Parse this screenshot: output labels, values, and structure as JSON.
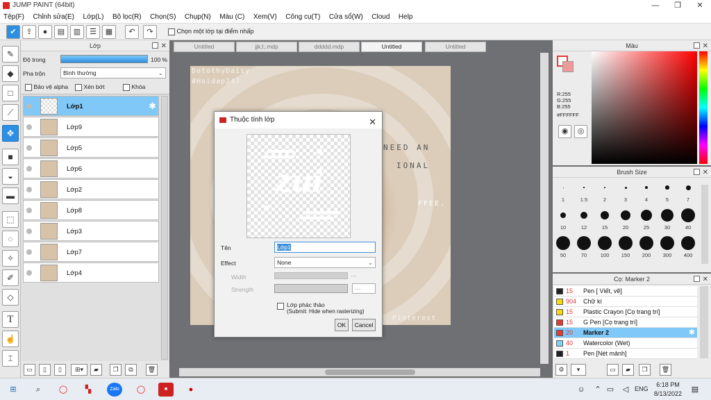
{
  "window": {
    "title": "JUMP PAINT (64bit)",
    "minimize": "—",
    "maximize": "❐",
    "close": "✕"
  },
  "menu": [
    "Tệp(F)",
    "Chỉnh sửa(E)",
    "Lớp(L)",
    "Bộ lọc(R)",
    "Chọn(S)",
    "Chụp(N)",
    "Màu (C)",
    "Xem(V)",
    "Công cụ(T)",
    "Cửa sổ(W)",
    "Cloud",
    "Help"
  ],
  "toolbar": {
    "select_layer_checkbox": "Chọn một lớp tại điểm nhấp"
  },
  "layer_panel": {
    "title": "Lớp",
    "opacity_label": "Độ trong",
    "opacity_value": "100 %",
    "opacity_fraction": 1.0,
    "blend_label": "Pha trộn",
    "blend_value": "Bình thường",
    "protect_alpha": "Bảo vệ alpha",
    "clipping": "Xén bớt",
    "lock": "Khóa",
    "layers": [
      {
        "name": "Lớp1",
        "selected": true,
        "thumb": "checker"
      },
      {
        "name": "Lớp9",
        "selected": false,
        "thumb": "photo"
      },
      {
        "name": "Lớp5",
        "selected": false,
        "thumb": "photo"
      },
      {
        "name": "Lớp6",
        "selected": false,
        "thumb": "photo"
      },
      {
        "name": "Lớp2",
        "selected": false,
        "thumb": "photo"
      },
      {
        "name": "Lớp8",
        "selected": false,
        "thumb": "photo"
      },
      {
        "name": "Lớp3",
        "selected": false,
        "thumb": "photo"
      },
      {
        "name": "Lớp7",
        "selected": false,
        "thumb": "photo"
      },
      {
        "name": "Lớp4",
        "selected": false,
        "thumb": "photo"
      }
    ]
  },
  "tabs": [
    {
      "label": "Untitled",
      "active": false
    },
    {
      "label": "jjk;l;.mdp",
      "active": false
    },
    {
      "label": "ddddd.mdp",
      "active": false
    },
    {
      "label": "Untitled",
      "active": true
    },
    {
      "label": "Untitled",
      "active": false
    }
  ],
  "artwork": {
    "watermark_top_1": "DotothyDaisy",
    "watermark_top_2": "#Hoidap247",
    "watermark_bottom": ": Pinterest",
    "text_1": "NEED AN",
    "text_2": "IONAL",
    "text_3": "FFEE."
  },
  "dialog": {
    "title": "Thuộc tính lớp",
    "name_label": "Tên",
    "name_value": "Lớp1",
    "effect_label": "Effect",
    "effect_value": "None",
    "width_label": "Width",
    "width_value": "---",
    "strength_label": "Strength",
    "strength_value": "---",
    "draft_label": "Lớp phác thảo",
    "draft_sub": "(Submit: Hide when rasterizing)",
    "ok": "OK",
    "cancel": "Cancel",
    "preview_text": "zui"
  },
  "color_panel": {
    "title": "Màu",
    "r": "R:255",
    "g": "G:255",
    "b": "B:255",
    "hex": "#FFFFFF",
    "foreground": "#e53935",
    "background": "#ffffff"
  },
  "brush_panel": {
    "title": "Brush Size",
    "sizes": [
      "1",
      "1.5",
      "2",
      "3",
      "4",
      "5",
      "7",
      "10",
      "12",
      "15",
      "20",
      "25",
      "30",
      "40",
      "50",
      "70",
      "100",
      "150",
      "200",
      "300",
      "400"
    ]
  },
  "marker_panel": {
    "title": "Cọ: Marker 2",
    "items": [
      {
        "size": "15",
        "name": "Pen [ Viết, vẽ]",
        "color": "#222222",
        "selected": false
      },
      {
        "size": "904",
        "name": "Chữ kí",
        "color": "#f5d90a",
        "selected": false
      },
      {
        "size": "15",
        "name": "Plastic Crayon [Cọ trang trí]",
        "color": "#f5d90a",
        "selected": false
      },
      {
        "size": "15",
        "name": "G Pen [Cọ trang trí]",
        "color": "#e53935",
        "selected": false
      },
      {
        "size": "20",
        "name": "Marker 2",
        "color": "#e53935",
        "selected": true
      },
      {
        "size": "40",
        "name": "Watercolor (Wet)",
        "color": "#7fd3f5",
        "selected": false
      },
      {
        "size": "1",
        "name": "Pen [Nét mảnh]",
        "color": "#222222",
        "selected": false
      }
    ]
  },
  "taskbar": {
    "lang": "ENG",
    "time": "6:18 PM",
    "date": "8/13/2022"
  }
}
